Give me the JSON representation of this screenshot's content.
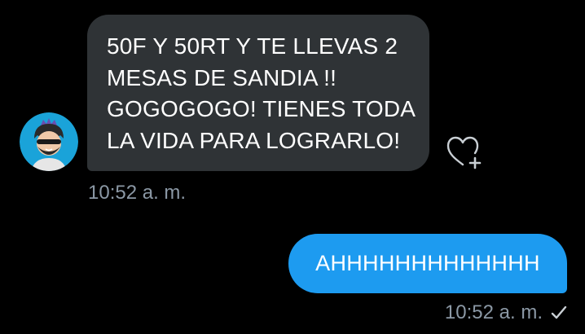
{
  "colors": {
    "background": "#000000",
    "incoming_bubble": "#2f3336",
    "outgoing_bubble": "#1d9bf0",
    "text": "#ffffff",
    "timestamp": "#8b98a5"
  },
  "incoming_message": {
    "avatar_icon": "cartoon-avatar-icon",
    "lines": [
      "50F Y 50RT Y TE LLEVAS 2",
      "MESAS DE SANDIA !!",
      "GOGOGOGO! TIENES TODA",
      "LA VIDA PARA LOGRARLO!"
    ],
    "reaction_icon": "heart-plus-icon",
    "time": "10:52 a. m."
  },
  "outgoing_message": {
    "text": "AHHHHHHHHHHHHH",
    "time": "10:52 a. m.",
    "status_icon": "check-icon"
  }
}
